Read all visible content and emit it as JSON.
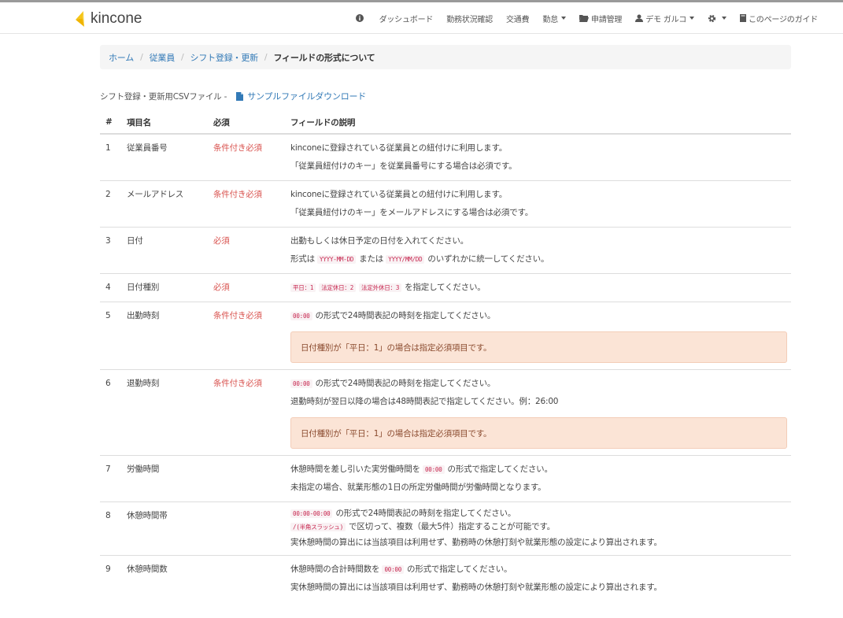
{
  "nav": {
    "brand": "kincone",
    "items": [
      {
        "label": "",
        "icon": "info-circle-icon",
        "caret": false
      },
      {
        "label": "ダッシュボード",
        "icon": "",
        "caret": false
      },
      {
        "label": "勤務状況確認",
        "icon": "",
        "caret": false
      },
      {
        "label": "交通費",
        "icon": "",
        "caret": false
      },
      {
        "label": "勤怠",
        "icon": "",
        "caret": true
      },
      {
        "label": "申請管理",
        "icon": "folder-icon",
        "caret": false
      },
      {
        "label": "デモ ガルコ",
        "icon": "user-icon",
        "caret": true
      },
      {
        "label": "",
        "icon": "gear-icon",
        "caret": true
      },
      {
        "label": "このページのガイド",
        "icon": "book-icon",
        "caret": false
      }
    ]
  },
  "breadcrumb": {
    "home": "ホーム",
    "employees": "従業員",
    "shift": "シフト登録・更新",
    "current": "フィールドの形式について",
    "sep": "/"
  },
  "intro": {
    "text": "シフト登録・更新用CSVファイル -",
    "download": "サンプルファイルダウンロード"
  },
  "table": {
    "headers": {
      "num": "#",
      "name": "項目名",
      "required": "必須",
      "desc": "フィールドの説明"
    },
    "rows": [
      {
        "num": "1",
        "name": "従業員番号",
        "required": "条件付き必須",
        "lines": [
          [
            {
              "t": "kinconeに登録されている従業員との紐付けに利用します。"
            }
          ],
          [
            {
              "t": "「従業員紐付けのキー」を従業員番号にする場合は必須です。"
            }
          ]
        ],
        "alert": ""
      },
      {
        "num": "2",
        "name": "メールアドレス",
        "required": "条件付き必須",
        "lines": [
          [
            {
              "t": "kinconeに登録されている従業員との紐付けに利用します。"
            }
          ],
          [
            {
              "t": "「従業員紐付けのキー」をメールアドレスにする場合は必須です。"
            }
          ]
        ],
        "alert": ""
      },
      {
        "num": "3",
        "name": "日付",
        "required": "必須",
        "lines": [
          [
            {
              "t": "出勤もしくは休日予定の日付を入れてください。"
            }
          ],
          [
            {
              "t": "形式は "
            },
            {
              "c": "YYYY-MM-DD"
            },
            {
              "t": "または "
            },
            {
              "c": "YYYY/MM/DD"
            },
            {
              "t": "のいずれかに統一してください。"
            }
          ]
        ],
        "alert": ""
      },
      {
        "num": "4",
        "name": "日付種別",
        "required": "必須",
        "lines": [
          [
            {
              "c": "平日：1"
            },
            {
              "c": "法定休日：2"
            },
            {
              "c": "法定外休日：3"
            },
            {
              "t": "を指定してください。"
            }
          ]
        ],
        "alert": ""
      },
      {
        "num": "5",
        "name": "出勤時刻",
        "required": "条件付き必須",
        "lines": [
          [
            {
              "c": "00:00"
            },
            {
              "t": "の形式で24時間表記の時刻を指定してください。"
            }
          ]
        ],
        "alert": "日付種別が「平日：1」の場合は指定必須項目です。"
      },
      {
        "num": "6",
        "name": "退勤時刻",
        "required": "条件付き必須",
        "lines": [
          [
            {
              "c": "00:00"
            },
            {
              "t": "の形式で24時間表記の時刻を指定してください。"
            }
          ],
          [
            {
              "t": "退勤時刻が翌日以降の場合は48時間表記で指定してください。例：26:00"
            }
          ]
        ],
        "alert": "日付種別が「平日：1」の場合は指定必須項目です。"
      },
      {
        "num": "7",
        "name": "労働時間",
        "required": "",
        "lines": [
          [
            {
              "t": "休憩時間を差し引いた実労働時間を "
            },
            {
              "c": "00:00"
            },
            {
              "t": "の形式で指定してください。"
            }
          ],
          [
            {
              "t": "未指定の場合、就業形態の1日の所定労働時間が労働時間となります。"
            }
          ]
        ],
        "alert": ""
      },
      {
        "num": "8",
        "name": "休憩時間帯",
        "required": "",
        "tight": true,
        "lines": [
          [
            {
              "c": "00:00-00:00"
            },
            {
              "t": "の形式で24時間表記の時刻を指定してください。"
            }
          ],
          [
            {
              "c": "/(半角スラッシュ)"
            },
            {
              "t": "で区切って、複数（最大5件）指定することが可能です。"
            }
          ],
          [
            {
              "t": "実休憩時間の算出には当該項目は利用せず、勤務時の休憩打刻や就業形態の設定により算出されます。"
            }
          ]
        ],
        "alert": ""
      },
      {
        "num": "9",
        "name": "休憩時間数",
        "required": "",
        "lines": [
          [
            {
              "t": "休憩時間の合計時間数を "
            },
            {
              "c": "00:00"
            },
            {
              "t": "の形式で指定してください。"
            }
          ],
          [
            {
              "t": "実休憩時間の算出には当該項目は利用せず、勤務時の休憩打刻や就業形態の設定により算出されます。"
            }
          ]
        ],
        "alert": ""
      }
    ]
  }
}
